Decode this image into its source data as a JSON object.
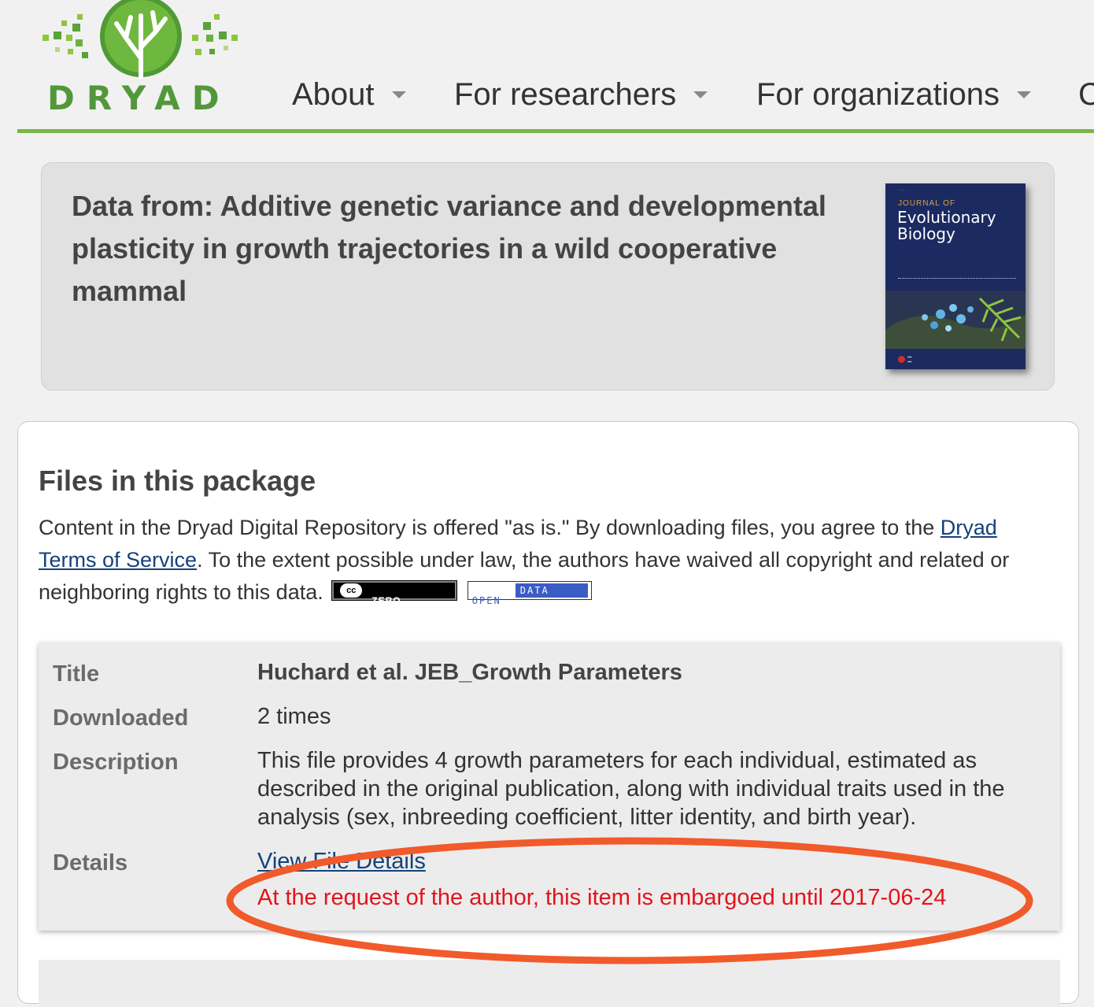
{
  "brand": {
    "wordmark": "DRYAD",
    "color": "#52983a",
    "rule_color": "#7ab648"
  },
  "nav": {
    "items": [
      {
        "label": "About"
      },
      {
        "label": "For researchers"
      },
      {
        "label": "For organizations"
      },
      {
        "label": "C"
      }
    ]
  },
  "dataset": {
    "title": "Data from: Additive genetic variance and developmental plasticity in growth trajectories in a wild cooperative mammal",
    "journal_cover": {
      "journal_of": "JOURNAL OF",
      "journal_name": "Evolutionary Biology",
      "cover_color": "#1c2a62"
    }
  },
  "files": {
    "heading": "Files in this package",
    "intro_part1": "Content in the Dryad Digital Repository is offered \"as is.\" By downloading files, you agree to the ",
    "terms_link": "Dryad Terms of Service",
    "intro_part2": ". To the extent possible under law, the authors have waived all copyright and related or neighboring rights to this data.",
    "badges": {
      "cc_zero": {
        "cc": "cc",
        "label": "ZERO"
      },
      "open_data": {
        "open": "OPEN",
        "data": "DATA"
      }
    },
    "record": {
      "title_label": "Title",
      "title_value": "Huchard et al. JEB_Growth Parameters",
      "downloaded_label": "Downloaded",
      "downloaded_value": "2 times",
      "description_label": "Description",
      "description_value": "This file provides 4 growth parameters for each individual, estimated as described in the original publication, along with individual traits used in the analysis (sex, inbreeding coefficient, litter identity, and birth year).",
      "details_label": "Details",
      "details_link": "View File Details",
      "embargo_notice": "At the request of the author, this item is embargoed until 2017-06-24",
      "embargo_color": "#e3131b"
    }
  },
  "annotation": {
    "shape": "ellipse",
    "color": "#f15a2b"
  }
}
